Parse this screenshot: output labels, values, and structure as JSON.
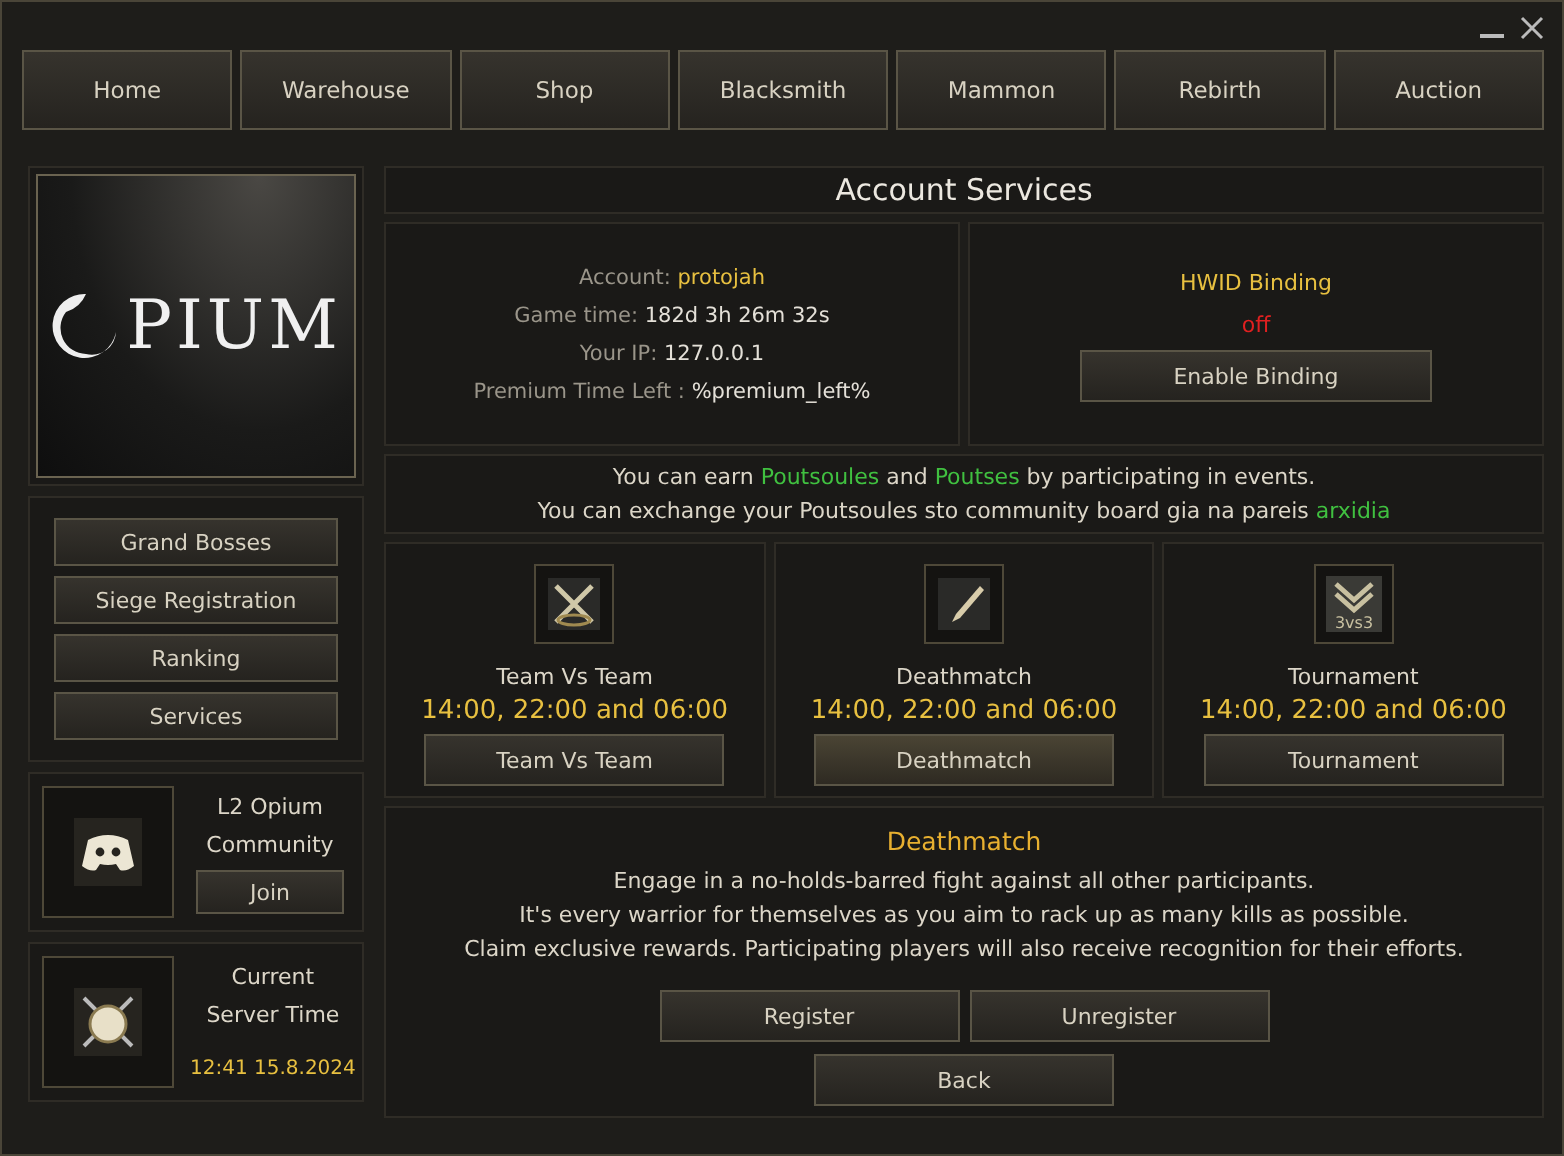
{
  "nav": [
    {
      "label": "Home"
    },
    {
      "label": "Warehouse"
    },
    {
      "label": "Shop"
    },
    {
      "label": "Blacksmith"
    },
    {
      "label": "Mammon"
    },
    {
      "label": "Rebirth"
    },
    {
      "label": "Auction"
    }
  ],
  "logo": {
    "text": "PIUM"
  },
  "menu": [
    {
      "label": "Grand Bosses"
    },
    {
      "label": "Siege Registration"
    },
    {
      "label": "Ranking"
    },
    {
      "label": "Services"
    }
  ],
  "community": {
    "lines": [
      "L2 Opium",
      "Community"
    ],
    "button": "Join"
  },
  "server_time": {
    "lines": [
      "Current",
      "Server Time"
    ],
    "value": "12:41 15.8.2024"
  },
  "title": "Account Services",
  "account": [
    {
      "label": "Account:",
      "value": "protojah",
      "kind": "highlight"
    },
    {
      "label": "Game time:",
      "value": "182d 3h 26m 32s",
      "kind": "plain"
    },
    {
      "label": "Your IP:",
      "value": "127.0.0.1",
      "kind": "plain"
    },
    {
      "label": "Premium Time Left :",
      "value": "%premium_left%",
      "kind": "plain"
    }
  ],
  "hwid": {
    "title": "HWID Binding",
    "on": false,
    "status": "off",
    "button": "Enable Binding"
  },
  "message": [
    [
      {
        "text": "You can earn ",
        "highlight": false
      },
      {
        "text": "Poutsoules",
        "highlight": true
      },
      {
        "text": " and ",
        "highlight": false
      },
      {
        "text": "Poutses",
        "highlight": true
      },
      {
        "text": " by participating in events.",
        "highlight": false
      }
    ],
    [
      {
        "text": "You can exchange your Poutsoules sto community board gia na pareis ",
        "highlight": false
      },
      {
        "text": "arxidia",
        "highlight": true
      }
    ]
  ],
  "events": [
    {
      "kind": "team",
      "name": "Team Vs Team",
      "schedule": "14:00, 22:00 and 06:00",
      "button": "Team Vs Team",
      "selected": false
    },
    {
      "kind": "deathmatch",
      "name": "Deathmatch",
      "schedule": "14:00, 22:00 and 06:00",
      "button": "Deathmatch",
      "selected": true
    },
    {
      "kind": "tournament",
      "icon_label": "3vs3",
      "name": "Tournament",
      "schedule": "14:00, 22:00 and 06:00",
      "button": "Tournament",
      "selected": false
    }
  ],
  "detail": {
    "title": "Deathmatch",
    "lines": [
      "Engage in a no-holds-barred fight against all other participants.",
      "It's every warrior for themselves as you aim to rack up as many kills as possible.",
      "Claim exclusive rewards. Participating players will also receive recognition for their efforts."
    ],
    "buttons": [
      "Register",
      "Unregister"
    ],
    "back": "Back"
  }
}
